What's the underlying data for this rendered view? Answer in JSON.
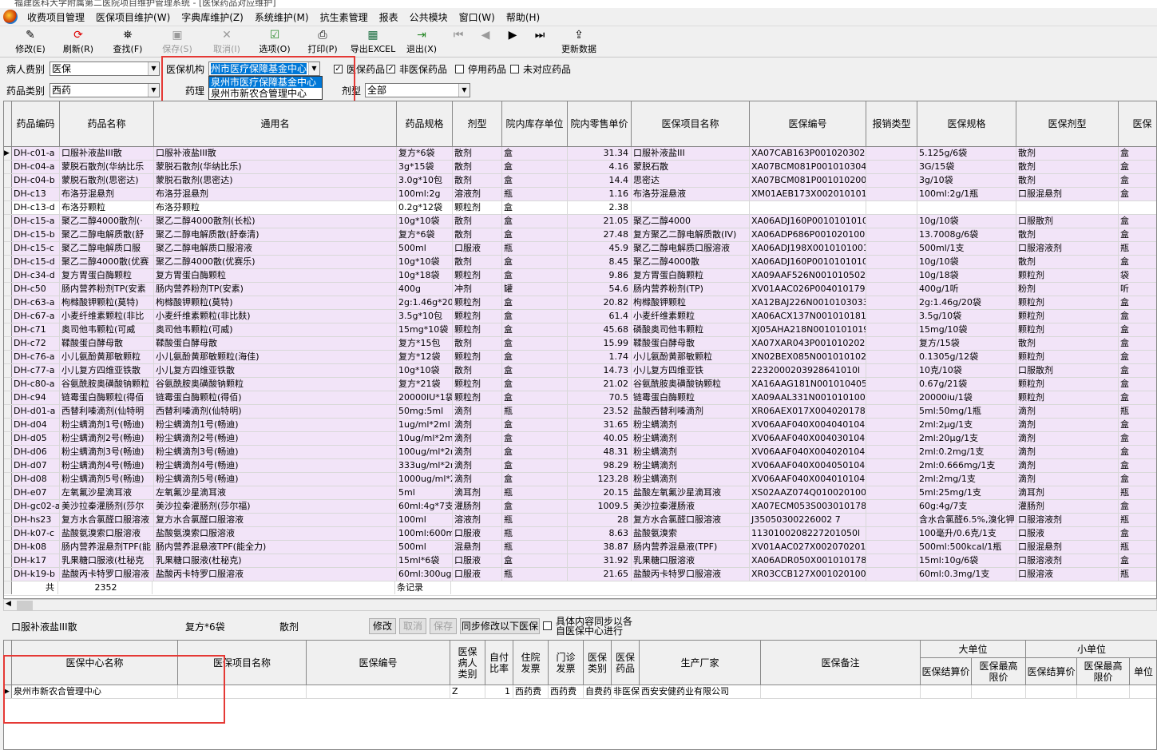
{
  "window": {
    "title": "福建医科大学附属第二医院项目维护管理系统 - [医保药品对应维护]"
  },
  "menu": [
    "收费项目管理",
    "医保项目维护(W)",
    "字典库维护(Z)",
    "系统维护(M)",
    "抗生素管理",
    "报表",
    "公共模块",
    "窗口(W)",
    "帮助(H)"
  ],
  "toolbar": {
    "modify": "修改(E)",
    "refresh": "刷新(R)",
    "search": "查找(F)",
    "save": "保存(S)",
    "cancel": "取消(I)",
    "options": "选项(O)",
    "print": "打印(P)",
    "export": "导出EXCEL",
    "exit": "退出(X)",
    "update": "更新数据"
  },
  "icons": [
    "edit-icon",
    "refresh-icon",
    "binoculars-icon",
    "save-icon",
    "cancel-icon",
    "options-icon",
    "printer-icon",
    "excel-icon",
    "exit-icon",
    "first-icon",
    "prev-icon",
    "next-icon",
    "last-icon"
  ],
  "filters": {
    "patient_type_label": "病人费别",
    "patient_type": "医保",
    "insurer_label": "医保机构",
    "insurer": "州市医疗保障基金中心",
    "insurer_options": [
      "泉州市医疗保障基金中心",
      "泉州市新农合管理中心"
    ],
    "drug_class_label": "药品类别",
    "drug_class": "西药",
    "pharm_label": "药理",
    "pharm": "",
    "form_label": "剂型",
    "form": "全部",
    "chk_insured": "医保药品",
    "chk_noninsured": "非医保药品",
    "chk_disabled": "停用药品",
    "chk_unmatched": "未对应药品"
  },
  "grid": {
    "headers": [
      "药品编码",
      "药品名称",
      "通用名",
      "药品规格",
      "剂型",
      "院内库存单位",
      "院内零售单价",
      "医保项目名称",
      "医保编号",
      "报销类型",
      "医保规格",
      "医保剂型",
      "医保"
    ],
    "rows": [
      [
        "DH-c01-a",
        "口服补液盐III散",
        "口服补液盐III散",
        "复方*6袋",
        "散剂",
        "盒",
        "31.34",
        "口服补液盐III",
        "XA07CAB163P00102030245",
        "",
        "5.125g/6袋",
        "散剂",
        "盒"
      ],
      [
        "DH-c04-a",
        "蒙脱石散剂(华纳比乐",
        "蒙脱石散剂(华纳比乐)",
        "3g*15袋",
        "散剂",
        "盒",
        "4.16",
        "蒙脱石散",
        "XA07BCM081P00101030492",
        "",
        "3G/15袋",
        "散剂",
        "盒"
      ],
      [
        "DH-c04-b",
        "蒙脱石散剂(思密达)",
        "蒙脱石散剂(思密达)",
        "3.0g*10包",
        "散剂",
        "盒",
        "14.4",
        "思密达",
        "XA07BCM081P00101020084",
        "",
        "3g/10袋",
        "散剂",
        "盒"
      ],
      [
        "DH-c13",
        "布洛芬混悬剂",
        "布洛芬混悬剂",
        "100ml:2g",
        "溶液剂",
        "瓶",
        "1.16",
        "布洛芬混悬液",
        "XM01AEB173X00201010174",
        "",
        "100ml:2g/1瓶",
        "口服混悬剂",
        "盒"
      ],
      [
        "DH-c13-d",
        "布洛芬颗粒",
        "布洛芬颗粒",
        "0.2g*12袋",
        "颗粒剂",
        "盒",
        "2.38",
        "",
        "",
        "",
        "",
        "",
        ""
      ],
      [
        "DH-c15-a",
        "聚乙二醇4000散剂(·",
        "聚乙二醇4000散剂(长松)",
        "10g*10袋",
        "散剂",
        "盒",
        "21.05",
        "聚乙二醇4000",
        "XA06ADJ160P00101010100",
        "",
        "10g/10袋",
        "口服散剂",
        "盒"
      ],
      [
        "DH-c15-b",
        "聚乙二醇电解质散(舒",
        "聚乙二醇电解质散(舒泰清)",
        "复方*6袋",
        "散剂",
        "盒",
        "27.48",
        "复方聚乙二醇电解质散(IV)",
        "XA06ADP686P00102010023",
        "",
        "13.7008g/6袋",
        "散剂",
        "盒"
      ],
      [
        "DH-c15-c",
        "聚乙二醇电解质口服",
        "聚乙二醇电解质口服溶液",
        "500ml",
        "口服液",
        "瓶",
        "45.9",
        "聚乙二醇电解质口服溶液",
        "XA06ADJ198X00101010012",
        "",
        "500ml/1支",
        "口服溶液剂",
        "瓶"
      ],
      [
        "DH-c15-d",
        "聚乙二醇4000散(优赛",
        "聚乙二醇4000散(优赛乐)",
        "10g*10袋",
        "散剂",
        "盒",
        "8.45",
        "聚乙二醇4000散",
        "XA06ADJ160P00101010102",
        "",
        "10g/10袋",
        "散剂",
        "盒"
      ],
      [
        "DH-c34-d",
        "复方胃蛋白酶颗粒",
        "复方胃蛋白酶颗粒",
        "10g*18袋",
        "颗粒剂",
        "盒",
        "9.86",
        "复方胃蛋白酶颗粒",
        "XA09AAF526N00101050213",
        "",
        "10g/18袋",
        "颗粒剂",
        "袋"
      ],
      [
        "DH-c50",
        "肠内营养粉剂TP(安素",
        "肠内营养粉剂TP(安素)",
        "400g",
        "冲剂",
        "罐",
        "54.6",
        "肠内营养粉剂(TP)",
        "XV01AAC026P00401017936",
        "",
        "400g/1听",
        "粉剂",
        "听"
      ],
      [
        "DH-c63-a",
        "枸橼酸钾颗粒(莫特)",
        "枸橼酸钾颗粒(莫特)",
        "2g:1.46g*20",
        "颗粒剂",
        "盒",
        "20.82",
        "枸橼酸钾颗粒",
        "XA12BAJ226N00101030330",
        "",
        "2g:1.46g/20袋",
        "颗粒剂",
        "盒"
      ],
      [
        "DH-c67-a",
        "小麦纤维素颗粒(非比",
        "小麦纤维素颗粒(非比麸)",
        "3.5g*10包",
        "颗粒剂",
        "盒",
        "61.4",
        "小麦纤维素颗粒",
        "XA06ACX137N00101018199",
        "",
        "3.5g/10袋",
        "颗粒剂",
        "盒"
      ],
      [
        "DH-c71",
        "奥司他韦颗粒(可威",
        "奥司他韦颗粒(可威)",
        "15mg*10袋",
        "颗粒剂",
        "盒",
        "45.68",
        "磷酸奥司他韦颗粒",
        "XJ05AHA218N00101010199",
        "",
        "15mg/10袋",
        "颗粒剂",
        "盒"
      ],
      [
        "DH-c72",
        "鞣酸蛋白酵母散",
        "鞣酸蛋白酵母散",
        "复方*15包",
        "散剂",
        "盒",
        "15.99",
        "鞣酸蛋白酵母散",
        "XA07XAR043P00101020234",
        "",
        "复方/15袋",
        "散剂",
        "盒"
      ],
      [
        "DH-c76-a",
        "小儿氨酚黄那敏颗粒",
        "小儿氨酚黄那敏颗粒(海佳)",
        "复方*12袋",
        "颗粒剂",
        "盒",
        "1.74",
        "小儿氨酚黄那敏颗粒",
        "XN02BEX085N00101010289",
        "",
        "0.1305g/12袋",
        "颗粒剂",
        "盒"
      ],
      [
        "DH-c77-a",
        "小儿复方四维亚铁散",
        "小儿复方四维亚铁散",
        "10g*10袋",
        "散剂",
        "盒",
        "14.73",
        "小儿复方四维亚铁",
        "2232000203928641010l",
        "",
        "10克/10袋",
        "口服散剂",
        "盒"
      ],
      [
        "DH-c80-a",
        "谷氨酰胺奥磺酸钠颗粒",
        "谷氨酰胺奥磺酸钠颗粒",
        "复方*21袋",
        "颗粒剂",
        "盒",
        "21.02",
        "谷氨酰胺奥磺酸钠颗粒",
        "XA16AAG181N00101040577",
        "",
        "0.67g/21袋",
        "颗粒剂",
        "盒"
      ],
      [
        "DH-c94",
        "链霉蛋白酶颗粒(得佰",
        "链霉蛋白酶颗粒(得佰)",
        "20000IU*1袋",
        "颗粒剂",
        "盒",
        "70.5",
        "链霉蛋白酶颗粒",
        "XA09AAL331N00101010015",
        "",
        "20000iu/1袋",
        "颗粒剂",
        "盒"
      ],
      [
        "DH-d01-a",
        "西替利嗪滴剂(仙特明",
        "西替利嗪滴剂(仙特明)",
        "50mg:5ml",
        "滴剂",
        "瓶",
        "23.52",
        "盐酸西替利嗪滴剂",
        "XR06AEX017X00402017892",
        "",
        "5ml:50mg/1瓶",
        "滴剂",
        "瓶"
      ],
      [
        "DH-d04",
        "粉尘螨滴剂1号(畅迪)",
        "粉尘螨滴剂1号(畅迪)",
        "1ug/ml*2ml",
        "滴剂",
        "盒",
        "31.65",
        "粉尘螨滴剂",
        "XV06AAF040X00404010473",
        "",
        "2ml:2μg/1支",
        "滴剂",
        "盒"
      ],
      [
        "DH-d05",
        "粉尘螨滴剂2号(畅迪)",
        "粉尘螨滴剂2号(畅迪)",
        "10ug/ml*2ml",
        "滴剂",
        "盒",
        "40.05",
        "粉尘螨滴剂",
        "XV06AAF040X00403010473",
        "",
        "2ml:20μg/1支",
        "滴剂",
        "盒"
      ],
      [
        "DH-d06",
        "粉尘螨滴剂3号(畅迪)",
        "粉尘螨滴剂3号(畅迪)",
        "100ug/ml*2m",
        "滴剂",
        "盒",
        "48.31",
        "粉尘螨滴剂",
        "XV06AAF040X00402010473",
        "",
        "2ml:0.2mg/1支",
        "滴剂",
        "盒"
      ],
      [
        "DH-d07",
        "粉尘螨滴剂4号(畅迪)",
        "粉尘螨滴剂4号(畅迪)",
        "333ug/ml*2m",
        "滴剂",
        "盒",
        "98.29",
        "粉尘螨滴剂",
        "XV06AAF040X00405010473",
        "",
        "2ml:0.666mg/1支",
        "滴剂",
        "盒"
      ],
      [
        "DH-d08",
        "粉尘螨滴剂5号(畅迪)",
        "粉尘螨滴剂5号(畅迪)",
        "1000ug/ml*2",
        "滴剂",
        "盒",
        "123.28",
        "粉尘螨滴剂",
        "XV06AAF040X00401010473",
        "",
        "2ml:2mg/1支",
        "滴剂",
        "盒"
      ],
      [
        "DH-e07",
        "左氧氟沙星滴耳液",
        "左氧氟沙星滴耳液",
        "5ml",
        "滴耳剂",
        "瓶",
        "20.15",
        "盐酸左氧氟沙星滴耳液",
        "XS02AAZ074Q01002010054",
        "",
        "5ml:25mg/1支",
        "滴耳剂",
        "瓶"
      ],
      [
        "DH-gc02-a",
        "美沙拉秦灌肠剂(莎尔",
        "美沙拉秦灌肠剂(莎尔福)",
        "60ml:4g*7支",
        "灌肠剂",
        "盒",
        "1009.5",
        "美沙拉秦灌肠液",
        "XA07ECM053S00301017837",
        "",
        "60g:4g/7支",
        "灌肠剂",
        "盒"
      ],
      [
        "DH-hs23",
        "复方水合氯醛口服溶液",
        "复方水合氯醛口服溶液",
        "100ml",
        "溶液剂",
        "瓶",
        "28",
        "复方水合氯醛口服溶液",
        "J35050300226002 7",
        "",
        "含水合氯醛6.5%,溴化钾",
        "口服溶液剂",
        "瓶"
      ],
      [
        "DH-k07-c",
        "盐酸氨溴索口服溶液",
        "盐酸氨溴索口服溶液",
        "100ml:600mg",
        "口服液",
        "瓶",
        "8.63",
        "盐酸氨溴索",
        "1130100208227201050l",
        "",
        "100毫升/0.6克/1支",
        "口服液",
        "盒"
      ],
      [
        "DH-k08",
        "肠内营养混悬剂TPF(能",
        "肠内营养混悬液TPF(能全力)",
        "500ml",
        "混悬剂",
        "瓶",
        "38.87",
        "肠内营养混悬液(TPF)",
        "XV01AAC027X00207020163",
        "",
        "500ml:500kcal/1瓶",
        "口服混悬剂",
        "瓶"
      ],
      [
        "DH-k17",
        "乳果糖口服液(杜秘克",
        "乳果糖口服液(杜秘克)",
        "15ml*6袋",
        "口服液",
        "盒",
        "31.92",
        "乳果糖口服溶液",
        "XA06ADR050X00101017889",
        "",
        "15ml:10g/6袋",
        "口服溶液剂",
        "盒"
      ],
      [
        "DH-k19-b",
        "盐酸丙卡特罗口服溶液",
        "盐酸丙卡特罗口服溶液",
        "60ml:300ug",
        "口服液",
        "瓶",
        "21.65",
        "盐酸丙卡特罗口服溶液",
        "XR03CCB127X00102010027",
        "",
        "60ml:0.3mg/1支",
        "口服溶液",
        "瓶"
      ]
    ],
    "footer": {
      "total_label": "共",
      "total": "2352",
      "unit": "条记录"
    }
  },
  "detail": {
    "name": "口服补液盐III散",
    "spec": "复方*6袋",
    "form": "散剂",
    "btn_modify": "修改",
    "btn_cancel": "取消",
    "btn_save": "保存",
    "btn_sync": "同步修改以下医保",
    "sync_note": "具体内容同步以各自医保中心进行"
  },
  "grid2": {
    "headers": {
      "center": "医保中心名称",
      "item": "医保项目名称",
      "code": "医保编号",
      "patient_type": "医保病人类别",
      "self_pay": "自付比率",
      "inpatient": "住院发票",
      "outpatient": "门诊发票",
      "ins_type": "医保类别",
      "ins_drug": "医保药品",
      "maker": "生产厂家",
      "remark": "医保备注",
      "big_unit": "大单位",
      "small_unit": "小单位",
      "big_price": "医保结算价",
      "big_max": "医保最高限价",
      "small_price": "医保结算价",
      "small_max": "医保最高限价",
      "unit": "单位"
    },
    "row": {
      "center": "泉州市新农合管理中心",
      "item": "",
      "code": "",
      "patient_type": "Z",
      "self_pay": "1",
      "inpatient": "西药费",
      "outpatient": "西药费",
      "ins_type": "自费药",
      "ins_drug": "非医保",
      "maker": "西安安健药业有限公司"
    }
  },
  "colors": {
    "pink_row": "#f2e4f8",
    "select": "#0078d7",
    "highlight_box": "#e53935"
  }
}
